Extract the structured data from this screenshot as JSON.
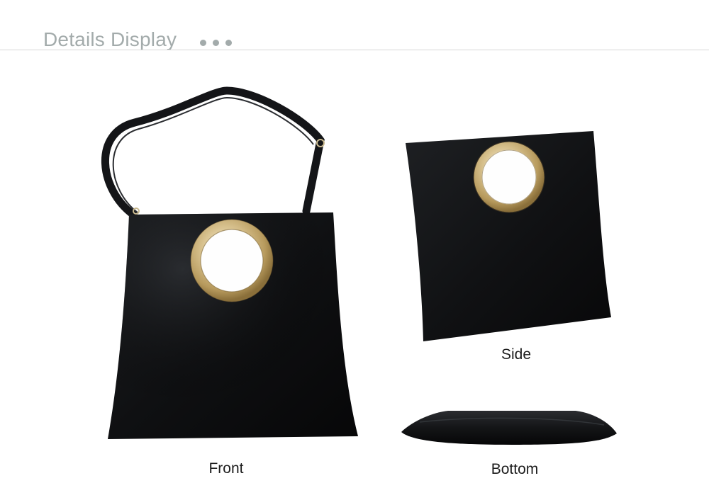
{
  "header": {
    "title": "Details Display"
  },
  "views": {
    "front": {
      "label": "Front"
    },
    "side": {
      "label": "Side"
    },
    "bottom": {
      "label": "Bottom"
    }
  },
  "colors": {
    "title": "#a3abab",
    "leather": "#121315",
    "ring": "#d9c79a"
  }
}
